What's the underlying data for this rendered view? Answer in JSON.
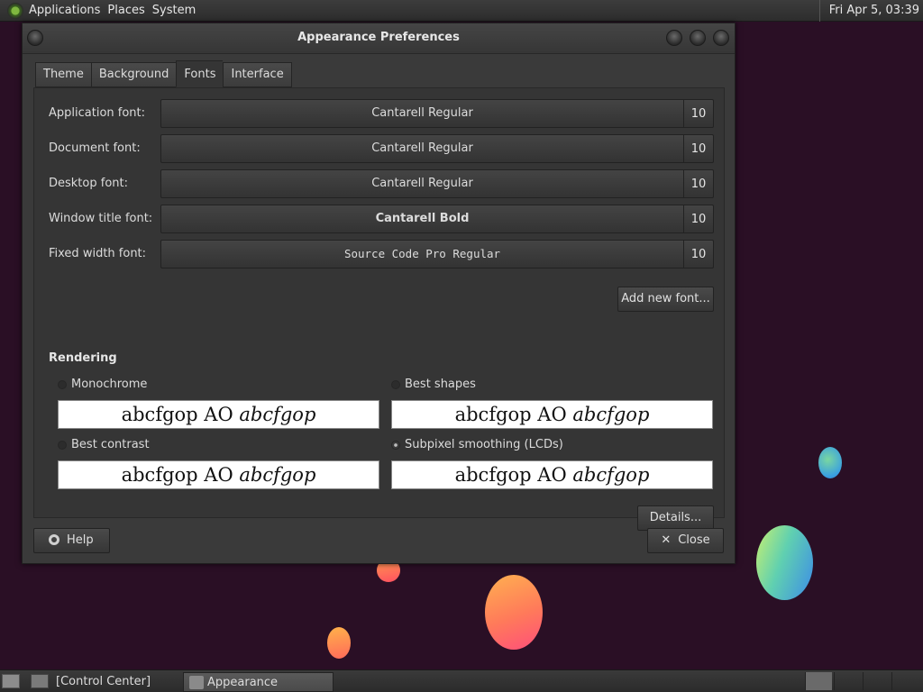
{
  "top_panel": {
    "menus": [
      "Applications",
      "Places",
      "System"
    ],
    "clock": "Fri Apr  5, 03:39"
  },
  "window": {
    "title": "Appearance Preferences",
    "tabs": [
      {
        "label": "Theme",
        "active": false
      },
      {
        "label": "Background",
        "active": false
      },
      {
        "label": "Fonts",
        "active": true
      },
      {
        "label": "Interface",
        "active": false
      }
    ],
    "fonts": [
      {
        "label": "Application font:",
        "font": "Cantarell Regular",
        "size": "10"
      },
      {
        "label": "Document font:",
        "font": "Cantarell Regular",
        "size": "10"
      },
      {
        "label": "Desktop font:",
        "font": "Cantarell Regular",
        "size": "10"
      },
      {
        "label": "Window title font:",
        "font": "Cantarell Bold",
        "size": "10"
      },
      {
        "label": "Fixed width font:",
        "font": "Source Code Pro Regular",
        "size": "10"
      }
    ],
    "add_font_label": "Add new font...",
    "rendering": {
      "title": "Rendering",
      "options": [
        {
          "label": "Monochrome",
          "checked": false
        },
        {
          "label": "Best shapes",
          "checked": false
        },
        {
          "label": "Best contrast",
          "checked": false
        },
        {
          "label": "Subpixel smoothing (LCDs)",
          "checked": true
        }
      ],
      "sample_regular": "abcfgop AO ",
      "sample_italic": "abcfgop"
    },
    "details_label": "Details...",
    "help_label": "Help",
    "close_label": "Close"
  },
  "taskbar": {
    "tasks": [
      {
        "label": "[Control Center]",
        "active": false
      },
      {
        "label": "Appearance Prefere...",
        "active": true
      }
    ]
  }
}
